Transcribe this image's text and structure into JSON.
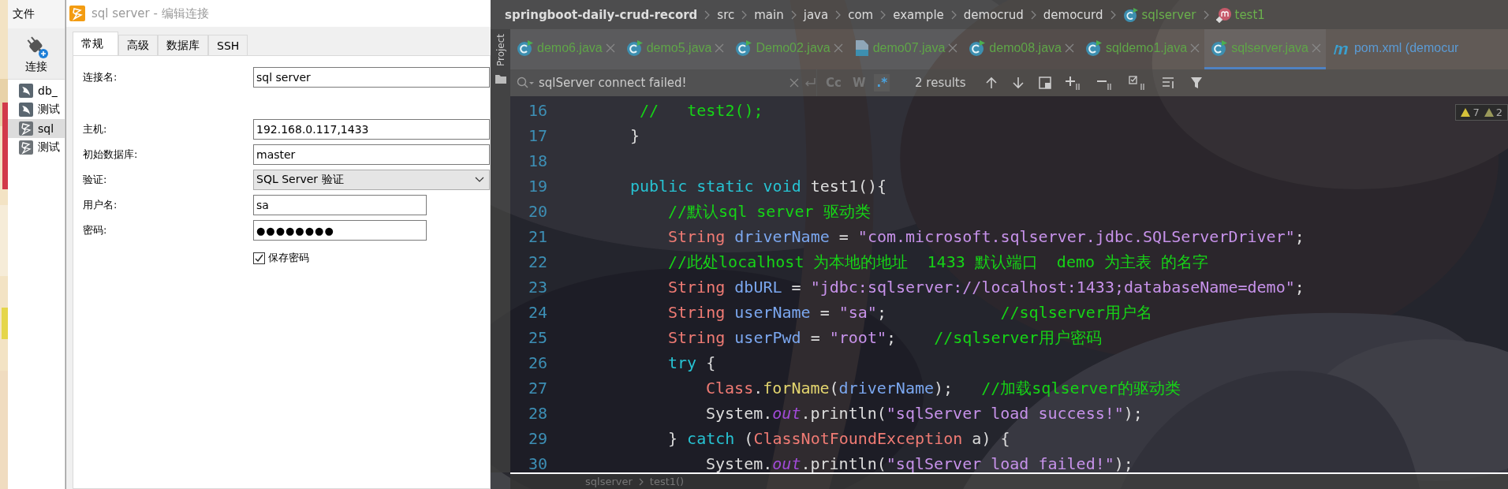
{
  "navicat": {
    "menu": [
      {
        "label": "文件"
      }
    ],
    "toolbar": [
      {
        "label": "连接"
      }
    ],
    "connections": [
      {
        "label": "db_",
        "kind": "mysql",
        "selected": false
      },
      {
        "label": "测试",
        "kind": "mysql",
        "selected": false
      },
      {
        "label": "sql",
        "kind": "sqlserver",
        "selected": true
      },
      {
        "label": "测试",
        "kind": "sqlserver",
        "selected": false
      }
    ]
  },
  "dialog": {
    "title": "sql server - 编辑连接",
    "tabs": [
      {
        "label": "常规",
        "selected": true
      },
      {
        "label": "高级",
        "selected": false
      },
      {
        "label": "数据库",
        "selected": false
      },
      {
        "label": "SSH",
        "selected": false
      }
    ],
    "fields": [
      {
        "label": "连接名:",
        "kind": "text",
        "value": "sql server"
      },
      {
        "label": "主机:",
        "kind": "text",
        "value": "192.168.0.117,1433"
      },
      {
        "label": "初始数据库:",
        "kind": "text",
        "value": "master"
      },
      {
        "label": "验证:",
        "kind": "select",
        "value": "SQL Server 验证"
      },
      {
        "label": "用户名:",
        "kind": "short",
        "value": "sa"
      },
      {
        "label": "密码:",
        "kind": "password",
        "value": "●●●●●●●●"
      }
    ],
    "checkbox": {
      "label": "保存密码",
      "checked": true
    }
  },
  "ide": {
    "breadcrumbs": [
      {
        "label": "springboot-daily-crud-record",
        "kind": "project"
      },
      {
        "label": "src",
        "kind": "folder"
      },
      {
        "label": "main",
        "kind": "folder"
      },
      {
        "label": "java",
        "kind": "folder"
      },
      {
        "label": "com",
        "kind": "folder"
      },
      {
        "label": "example",
        "kind": "folder"
      },
      {
        "label": "democrud",
        "kind": "folder"
      },
      {
        "label": "democurd",
        "kind": "folder"
      },
      {
        "label": "sqlserver",
        "kind": "class"
      },
      {
        "label": "test1",
        "kind": "method"
      }
    ],
    "side_strip": {
      "label": "Project"
    },
    "tabs": [
      {
        "label": "demo6.java",
        "kind": "class",
        "selected": false
      },
      {
        "label": "demo5.java",
        "kind": "class",
        "selected": false
      },
      {
        "label": "Demo02.java",
        "kind": "class",
        "selected": false
      },
      {
        "label": "demo07.java",
        "kind": "java-file",
        "selected": false
      },
      {
        "label": "demo08.java",
        "kind": "class",
        "selected": false
      },
      {
        "label": "sqldemo1.java",
        "kind": "class",
        "selected": false
      },
      {
        "label": "sqlserver.java",
        "kind": "class",
        "selected": true
      },
      {
        "label": "pom.xml (democur",
        "kind": "maven",
        "selected": false
      }
    ],
    "search": {
      "query": "sqlServer connect failed!",
      "options": [
        {
          "label": "Cc",
          "on": false
        },
        {
          "label": "W",
          "on": false
        },
        {
          "label": ".*",
          "on": true
        }
      ],
      "results": "2 results"
    },
    "problems": [
      {
        "kind": "warning",
        "count": "7"
      },
      {
        "kind": "weak-warning",
        "count": "2"
      }
    ],
    "code": [
      {
        "number": "16",
        "tokens": [
          {
            "kind": "comment",
            "text": " //   test2();"
          }
        ]
      },
      {
        "number": "17",
        "tokens": [
          {
            "kind": "plain",
            "text": "}"
          }
        ]
      },
      {
        "number": "18"
      },
      {
        "number": "19",
        "tokens": [
          {
            "kind": "keyword",
            "text": "public static void "
          },
          {
            "kind": "plain",
            "text": "test1(){"
          }
        ],
        "children": [
          {
            "number": "20",
            "tokens": [
              {
                "kind": "comment",
                "text": "//默认sql server 驱动类"
              }
            ]
          },
          {
            "number": "21",
            "tokens": [
              {
                "kind": "type",
                "text": "String "
              },
              {
                "kind": "variable",
                "text": "driverName"
              },
              {
                "kind": "plain",
                "text": " = "
              },
              {
                "kind": "string",
                "text": "\"com.microsoft.sqlserver.jdbc.SQLServerDriver\""
              },
              {
                "kind": "plain",
                "text": ";"
              }
            ]
          },
          {
            "number": "22",
            "tokens": [
              {
                "kind": "comment",
                "text": "//此处localhost 为本地的地址  1433 默认端口  demo 为主表 的名字"
              }
            ]
          },
          {
            "number": "23",
            "tokens": [
              {
                "kind": "type",
                "text": "String "
              },
              {
                "kind": "variable",
                "text": "dbURL"
              },
              {
                "kind": "plain",
                "text": " = "
              },
              {
                "kind": "string",
                "text": "\"jdbc:sqlserver://localhost:1433;databaseName=demo\""
              },
              {
                "kind": "plain",
                "text": ";"
              }
            ]
          },
          {
            "number": "24",
            "tokens": [
              {
                "kind": "type",
                "text": "String "
              },
              {
                "kind": "variable",
                "text": "userName"
              },
              {
                "kind": "plain",
                "text": " = "
              },
              {
                "kind": "string",
                "text": "\"sa\""
              },
              {
                "kind": "plain",
                "text": ";            "
              },
              {
                "kind": "comment",
                "text": "//sqlserver用户名"
              }
            ]
          },
          {
            "number": "25",
            "tokens": [
              {
                "kind": "type",
                "text": "String "
              },
              {
                "kind": "variable",
                "text": "userPwd"
              },
              {
                "kind": "plain",
                "text": " = "
              },
              {
                "kind": "string",
                "text": "\"root\""
              },
              {
                "kind": "plain",
                "text": ";    "
              },
              {
                "kind": "comment",
                "text": "//sqlserver用户密码"
              }
            ]
          },
          {
            "number": "26",
            "tokens": [
              {
                "kind": "keyword",
                "text": "try "
              },
              {
                "kind": "plain",
                "text": "{"
              }
            ],
            "children": [
              {
                "number": "27",
                "tokens": [
                  {
                    "kind": "type",
                    "text": "Class"
                  },
                  {
                    "kind": "plain",
                    "text": "."
                  },
                  {
                    "kind": "method",
                    "text": "forName"
                  },
                  {
                    "kind": "plain",
                    "text": "("
                  },
                  {
                    "kind": "variable",
                    "text": "driverName"
                  },
                  {
                    "kind": "plain",
                    "text": ");   "
                  },
                  {
                    "kind": "comment",
                    "text": "//加载sqlserver的驱动类"
                  }
                ]
              },
              {
                "number": "28",
                "tokens": [
                  {
                    "kind": "plain",
                    "text": "System."
                  },
                  {
                    "kind": "static",
                    "text": "out"
                  },
                  {
                    "kind": "plain",
                    "text": ".println("
                  },
                  {
                    "kind": "string",
                    "text": "\"sqlServer load success!\""
                  },
                  {
                    "kind": "plain",
                    "text": ");"
                  }
                ]
              }
            ]
          },
          {
            "number": "29",
            "tokens": [
              {
                "kind": "plain",
                "text": "} "
              },
              {
                "kind": "keyword",
                "text": "catch "
              },
              {
                "kind": "plain",
                "text": "("
              },
              {
                "kind": "type",
                "text": "ClassNotFoundException"
              },
              {
                "kind": "plain",
                "text": " a) {"
              }
            ],
            "children": [
              {
                "number": "30",
                "tokens": [
                  {
                    "kind": "plain",
                    "text": "System."
                  },
                  {
                    "kind": "static",
                    "text": "out"
                  },
                  {
                    "kind": "plain",
                    "text": ".println("
                  },
                  {
                    "kind": "string",
                    "text": "\"sqlServer load failed!\""
                  },
                  {
                    "kind": "plain",
                    "text": ");"
                  }
                ]
              }
            ]
          }
        ]
      }
    ],
    "status": [
      {
        "label": "sqlserver"
      },
      {
        "label": "test1()"
      }
    ]
  }
}
